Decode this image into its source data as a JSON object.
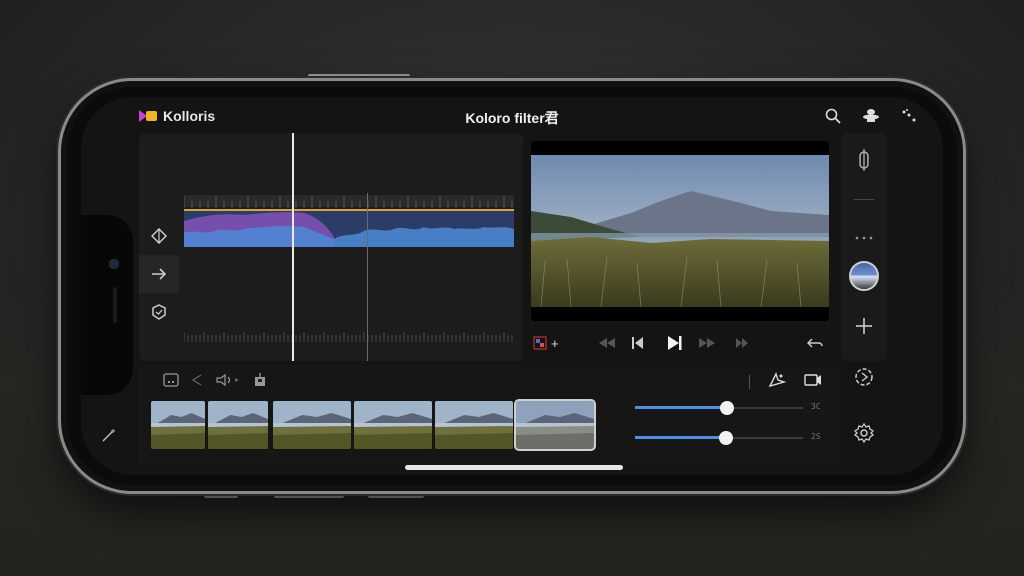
{
  "app": {
    "brand_name": "Kolloris",
    "title": "Koloro filter君",
    "colors": {
      "accent_blue": "#4f8fe0",
      "brand_pink": "#d43dd6",
      "brand_yellow": "#f2b32a",
      "waveform_purple": "#7a4fb0",
      "waveform_blue": "#3e78c8"
    }
  },
  "header": {
    "icons": [
      "search-icon",
      "filter-icon",
      "more-icon"
    ]
  },
  "timeline": {
    "tools": [
      "crop-tool-icon",
      "redo-icon",
      "shield-icon"
    ]
  },
  "transport": {
    "icons": [
      "media-add-icon",
      "rewind-icon",
      "step-back-icon",
      "play-icon",
      "fast-forward-icon",
      "step-forward-icon",
      "undo-icon"
    ],
    "add_label": "+"
  },
  "rail": {
    "icons": [
      "adjust-icon",
      "more-dots-icon",
      "profile-avatar",
      "add-icon",
      "timer-icon",
      "settings-icon"
    ]
  },
  "clip_tools": {
    "left": [
      "frame-icon",
      "split-icon",
      "audio-icon",
      "export-icon"
    ],
    "right": [
      "effects-icon",
      "camera-icon"
    ]
  },
  "clips": [
    {
      "id": 1
    },
    {
      "id": 2
    },
    {
      "id": 3
    },
    {
      "id": 4
    },
    {
      "id": 5
    },
    {
      "id": 6,
      "selected": true
    }
  ],
  "sliders": [
    {
      "name": "slider-top",
      "value": 0.55,
      "label": "3C"
    },
    {
      "name": "slider-bottom",
      "value": 0.54,
      "label": "2S"
    }
  ]
}
